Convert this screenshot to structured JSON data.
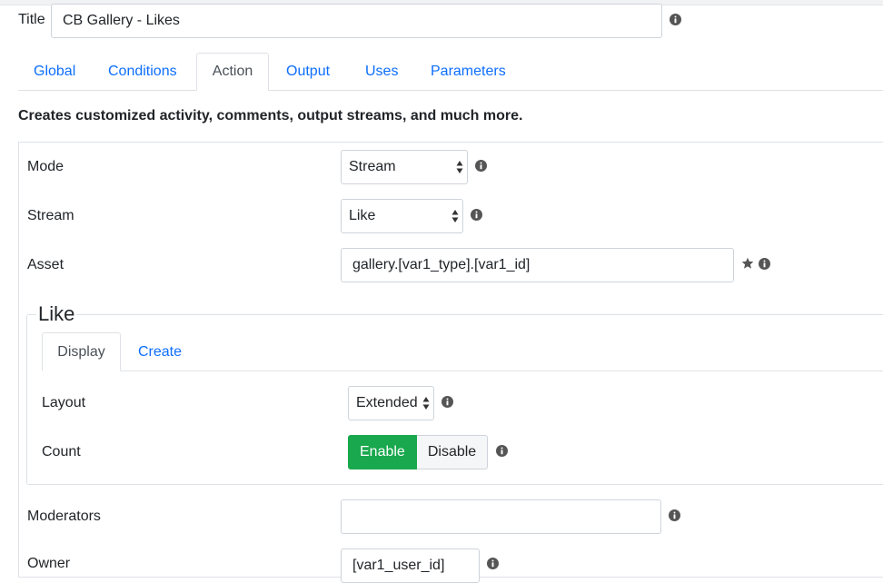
{
  "title_field": {
    "label": "Title",
    "value": "CB Gallery - Likes"
  },
  "tabs": [
    {
      "label": "Global"
    },
    {
      "label": "Conditions"
    },
    {
      "label": "Action"
    },
    {
      "label": "Output"
    },
    {
      "label": "Uses"
    },
    {
      "label": "Parameters"
    }
  ],
  "active_tab": "Action",
  "description": "Creates customized activity, comments, output streams, and much more.",
  "fields": {
    "mode": {
      "label": "Mode",
      "value": "Stream"
    },
    "stream": {
      "label": "Stream",
      "value": "Like"
    },
    "asset": {
      "label": "Asset",
      "value": "gallery.[var1_type].[var1_id]"
    },
    "moderators": {
      "label": "Moderators",
      "value": ""
    },
    "owner": {
      "label": "Owner",
      "value": "[var1_user_id]"
    }
  },
  "like": {
    "legend": "Like",
    "tabs": [
      {
        "label": "Display"
      },
      {
        "label": "Create"
      }
    ],
    "active_tab": "Display",
    "layout": {
      "label": "Layout",
      "value": "Extended"
    },
    "count": {
      "label": "Count",
      "options": [
        "Enable",
        "Disable"
      ],
      "selected": "Enable"
    }
  },
  "colors": {
    "link": "#0d6efd",
    "enable": "#19a84d"
  },
  "icons": {
    "info": "info-circle-icon",
    "required": "star-icon"
  }
}
